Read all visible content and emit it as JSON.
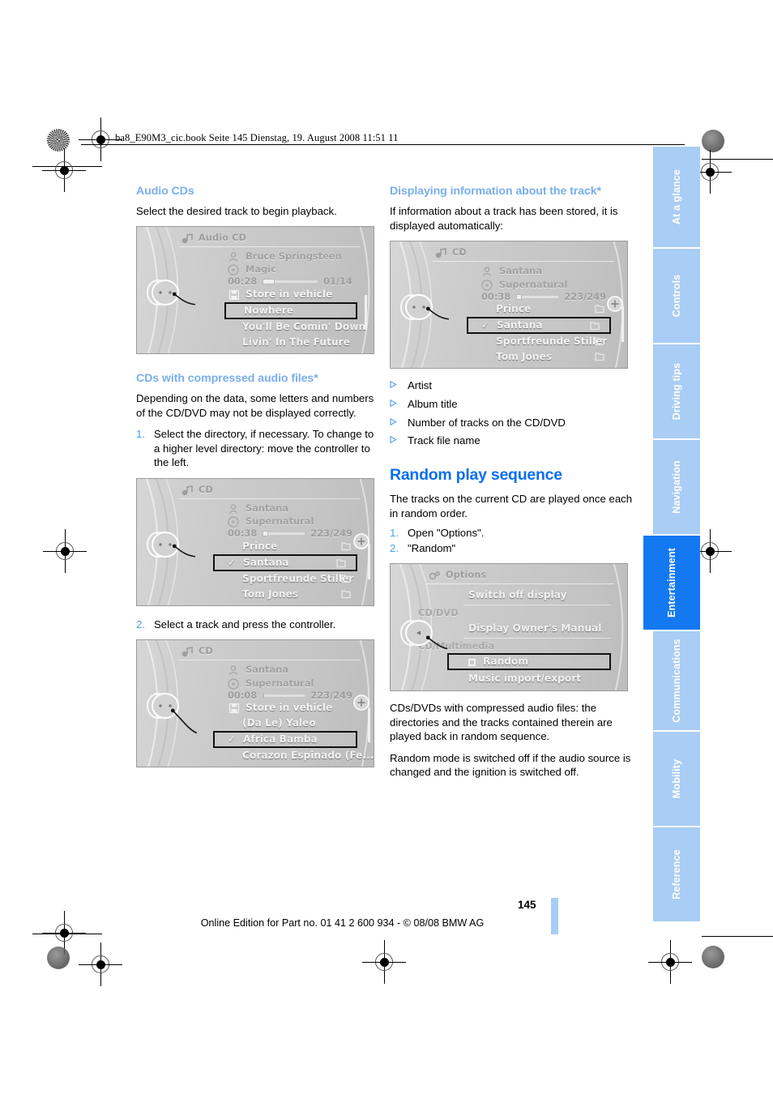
{
  "header": {
    "file_line": "ba8_E90M3_cic.book  Seite 145  Dienstag, 19. August 2008  11:51 11"
  },
  "left_column": {
    "heading_audio_cds": "Audio CDs",
    "audio_cds_text": "Select the desired track to begin playback.",
    "heading_compressed": "CDs with compressed audio files*",
    "compressed_text": "Depending on the data, some letters and numbers of the CD/DVD may not be displayed correctly.",
    "step1_num": "1.",
    "step1_text": "Select the directory, if necessary. To change to a higher level directory: move the controller to the left.",
    "step2_num": "2.",
    "step2_text": "Select a track and press the controller."
  },
  "right_column": {
    "heading_displaying": "Displaying information about the track*",
    "displaying_text": "If information about a track has been stored, it is displayed automatically:",
    "bullets": [
      "Artist",
      "Album title",
      "Number of tracks on the CD/DVD",
      "Track file name"
    ],
    "heading_random": "Random play sequence",
    "random_intro": "The tracks on the current CD are played once each in random order.",
    "step1_num": "1.",
    "step1_text": "Open \"Options\".",
    "step2_num": "2.",
    "step2_text": "\"Random\"",
    "note1": "CDs/DVDs with compressed audio files: the directories and the tracks contained therein are played back in random sequence.",
    "note2": "Random mode is switched off if the audio source is changed and the ignition is switched off."
  },
  "screenshots": {
    "audio_cd": {
      "title": "Audio CD",
      "artist": "Bruce Springsteen",
      "album": "Magic",
      "elapsed": "00:28",
      "counter": "01/14",
      "store_label": "Store in vehicle",
      "items": [
        {
          "label": "Nowhere",
          "selected": true,
          "check": false
        },
        {
          "label": "You'll Be Comin' Down",
          "selected": false,
          "check": false
        },
        {
          "label": "Livin' In The Future",
          "selected": false,
          "check": false
        }
      ]
    },
    "cd_directory": {
      "title": "CD",
      "artist": "Santana",
      "album": "Supernatural",
      "elapsed": "00:38",
      "counter": "223/249",
      "items": [
        {
          "label": "Prince",
          "selected": false,
          "check": false,
          "folder": true
        },
        {
          "label": "Santana",
          "selected": true,
          "check": true,
          "folder": true
        },
        {
          "label": "Sportfreunde Stiller",
          "selected": false,
          "check": false,
          "folder": true
        },
        {
          "label": "Tom Jones",
          "selected": false,
          "check": false,
          "folder": true
        }
      ]
    },
    "cd_tracks": {
      "title": "CD",
      "artist": "Santana",
      "album": "Supernatural",
      "elapsed": "00:08",
      "counter": "223/249",
      "store_label": "Store in vehicle",
      "items": [
        {
          "label": "(Da Le) Yaleo",
          "selected": false,
          "check": false
        },
        {
          "label": "Africa Bamba",
          "selected": true,
          "check": true
        },
        {
          "label": "Corazon Espinado (Fe...",
          "selected": false,
          "check": false
        }
      ]
    },
    "cd_info": {
      "title": "CD",
      "artist": "Santana",
      "album": "Supernatural",
      "elapsed": "00:38",
      "counter": "223/249",
      "items": [
        {
          "label": "Prince",
          "selected": false,
          "check": false,
          "folder": true
        },
        {
          "label": "Santana",
          "selected": true,
          "check": true,
          "folder": true
        },
        {
          "label": "Sportfreunde Stiller",
          "selected": false,
          "check": false,
          "folder": true
        },
        {
          "label": "Tom Jones",
          "selected": false,
          "check": false,
          "folder": true
        }
      ]
    },
    "options": {
      "title": "Options",
      "item_switch_off": "Switch off display",
      "section_cddvd": "CD/DVD",
      "item_owners_manual": "Display Owner's Manual",
      "section_cdmulti": "CD/Multimedia",
      "item_random": "Random",
      "item_music_import": "Music import/export"
    }
  },
  "side_tabs": [
    {
      "label": "At a glance",
      "active": false
    },
    {
      "label": "Controls",
      "active": false
    },
    {
      "label": "Driving tips",
      "active": false
    },
    {
      "label": "Navigation",
      "active": false
    },
    {
      "label": "Entertainment",
      "active": true
    },
    {
      "label": "Communications",
      "active": false
    },
    {
      "label": "Mobility",
      "active": false
    },
    {
      "label": "Reference",
      "active": false
    }
  ],
  "footer": {
    "page_number": "145",
    "edition": "Online Edition for Part no. 01 41 2 600 934 - © 08/08 BMW AG"
  },
  "colors": {
    "subhead_blue": "#7aaeec",
    "heading_blue": "#0b6ef2",
    "tab_blue": "#a9cdf4",
    "tab_active_blue": "#1478f0"
  }
}
